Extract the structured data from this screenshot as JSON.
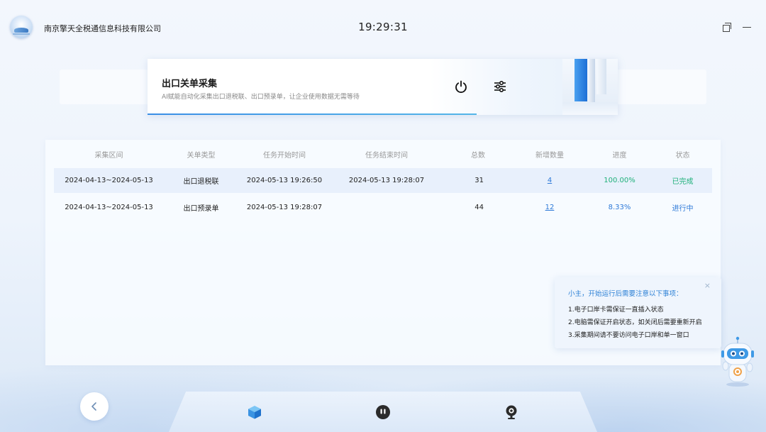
{
  "app": {
    "company_name": "南京擎天全税通信息科技有限公司",
    "clock": "19:29:31"
  },
  "header": {
    "title": "出口关单采集",
    "description": "AI赋能自动化采集出口退税联、出口预录单，让企业使用数据无需等待",
    "power_icon": "power-icon",
    "settings_icon": "sliders-icon"
  },
  "table": {
    "columns": [
      "采集区间",
      "关单类型",
      "任务开始时间",
      "任务结束时间",
      "总数",
      "新增数量",
      "进度",
      "状态"
    ],
    "rows": [
      {
        "range": "2024-04-13~2024-05-13",
        "type": "出口退税联",
        "start": "2024-05-13 19:26:50",
        "end": "2024-05-13 19:28:07",
        "total": "31",
        "new_count": "4",
        "progress": "100.00%",
        "status": "已完成"
      },
      {
        "range": "2024-04-13~2024-05-13",
        "type": "出口预录单",
        "start": "2024-05-13 19:28:07",
        "end": "",
        "total": "44",
        "new_count": "12",
        "progress": "8.33%",
        "status": "进行中"
      }
    ]
  },
  "notice": {
    "title": "小主，开始运行后需要注意以下事项：",
    "close": "×",
    "items": [
      "1.电子口岸卡需保证一直插入状态",
      "2.电脑需保证开启状态，如关闭后需要重新开启",
      "3.采集期间请不要访问电子口岸和单一窗口"
    ]
  },
  "dock": {
    "icons": [
      "back-icon",
      "cube-icon",
      "pause-icon",
      "camera-icon"
    ]
  },
  "colors": {
    "accent": "#2f7ad8",
    "success": "#1fb07a",
    "row_highlight": "#e8f0fc"
  }
}
